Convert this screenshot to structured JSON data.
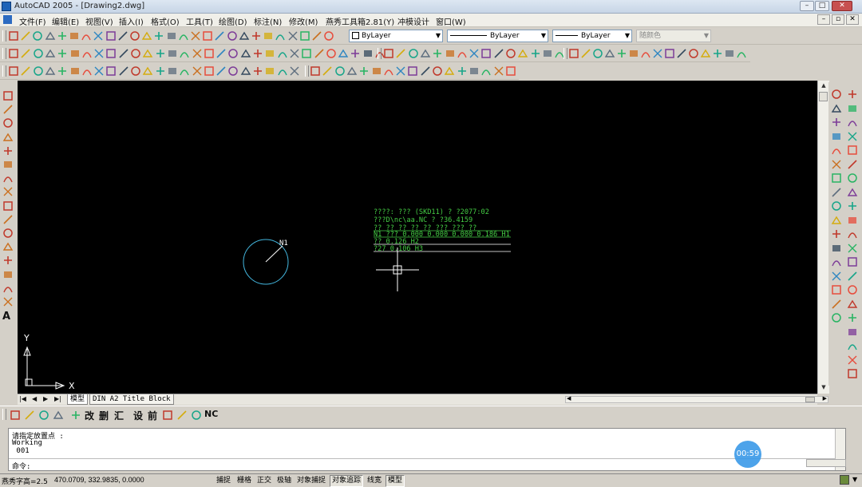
{
  "window": {
    "title": "AutoCAD 2005 - [Drawing2.dwg]",
    "minimize": "–",
    "maximize": "□",
    "close": "✕"
  },
  "menu": {
    "items": [
      "文件(F)",
      "编辑(E)",
      "视图(V)",
      "插入(I)",
      "格式(O)",
      "工具(T)",
      "绘图(D)",
      "标注(N)",
      "修改(M)",
      "燕秀工具箱2.81(Y)",
      "冲模设计",
      "窗口(W)"
    ],
    "mdi": [
      "–",
      "▫",
      "✕"
    ]
  },
  "properties": {
    "layer": "ByLayer",
    "linetype": "ByLayer",
    "lineweight": "ByLayer",
    "plotstyle": "随颜色"
  },
  "canvas": {
    "table_rows": [
      "????: ??? (SKD11)  ?  ?2077:02",
      "???D\\nc\\aa.NC    ?  ?36.4159",
      "?? ??   ??   ??   ?? ???   ???   ??",
      "N1  ???  0.000  0.000    0.000  0.186  H1",
      "??                               0.126  H2",
      "?27                              0.106  H3"
    ],
    "circle_label": "N1",
    "ucs": {
      "x": "X",
      "y": "Y"
    }
  },
  "colors": {
    "table": "#44cc44",
    "circle": "#44b8e0",
    "crosshair": "#ffffff",
    "timer": "#3a9ae8"
  },
  "tabs": {
    "nav": [
      "|◀",
      "◀",
      "▶",
      "▶|"
    ],
    "model": "模型",
    "layout": "DIN A2 Title Block"
  },
  "bottom_toolbar": {
    "glyphs": [
      "改",
      "删",
      "汇",
      "设",
      "前"
    ],
    "last": "NC"
  },
  "command": {
    "lines": [
      "请指定放置点 :",
      "Working",
      " 001"
    ],
    "prompt": "命令:"
  },
  "timer": "00:59",
  "status": {
    "label": "燕秀字高=2.5",
    "coords": "470.0709,  332.9835,  0.0000",
    "buttons": [
      {
        "label": "捕捉",
        "on": false
      },
      {
        "label": "栅格",
        "on": false
      },
      {
        "label": "正交",
        "on": false
      },
      {
        "label": "极轴",
        "on": false
      },
      {
        "label": "对象捕捉",
        "on": false
      },
      {
        "label": "对象追踪",
        "on": true
      },
      {
        "label": "线宽",
        "on": false
      },
      {
        "label": "模型",
        "on": true
      }
    ]
  }
}
